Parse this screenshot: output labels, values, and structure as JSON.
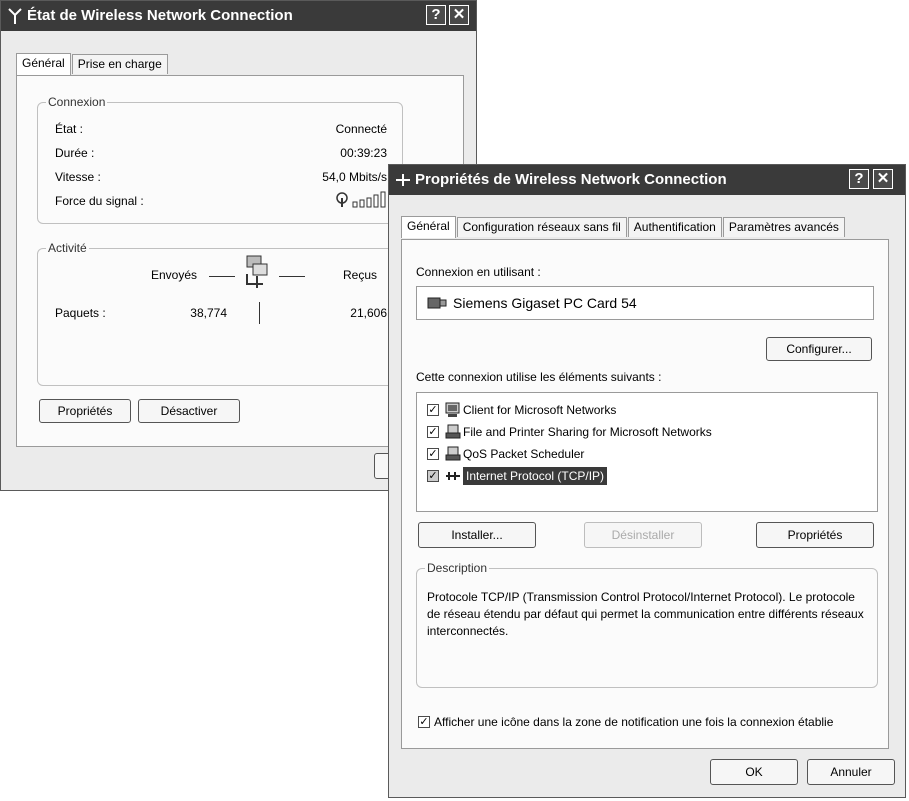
{
  "status_window": {
    "title": "État de Wireless Network Connection",
    "help_btn": "?",
    "close_btn": "✕",
    "tabs": [
      "Général",
      "Prise en charge"
    ],
    "connexion_legend": "Connexion",
    "rows": [
      {
        "label": "État :",
        "value": "Connecté"
      },
      {
        "label": "Durée :",
        "value": "00:39:23"
      },
      {
        "label": "Vitesse :",
        "value": "54,0 Mbits/s"
      },
      {
        "label": "Force du signal :",
        "value": ""
      }
    ],
    "activity_legend": "Activité",
    "sent_label": "Envoyés",
    "received_label": "Reçus",
    "packets_label": "Paquets :",
    "packets_sent": "38,774",
    "packets_received": "21,606",
    "properties_btn": "Propriétés",
    "disable_btn": "Désactiver",
    "signal_bars": 4
  },
  "props_window": {
    "title": "Propriétés de Wireless Network Connection",
    "help_btn": "?",
    "close_btn": "✕",
    "tabs": [
      "Général",
      "Configuration réseaux sans fil",
      "Authentification",
      "Paramètres avancés"
    ],
    "connect_using_label": "Connexion en utilisant :",
    "adapter_name": "Siemens Gigaset PC Card 54",
    "configure_btn": "Configurer...",
    "components_label": "Cette connexion utilise les éléments suivants :",
    "components": [
      {
        "name": "Client for Microsoft Networks",
        "checked": true
      },
      {
        "name": "File and Printer Sharing for Microsoft Networks",
        "checked": true
      },
      {
        "name": "QoS Packet Scheduler",
        "checked": true
      },
      {
        "name": "Internet Protocol (TCP/IP)",
        "checked": true,
        "selected": true
      }
    ],
    "install_btn": "Installer...",
    "uninstall_btn": "Désinstaller",
    "properties_btn": "Propriétés",
    "description_legend": "Description",
    "description_text": "Protocole TCP/IP (Transmission Control Protocol/Internet Protocol). Le protocole de réseau étendu par défaut qui permet la communication entre différents réseaux interconnectés.",
    "show_icon_label": "Afficher une icône dans la zone de notification une fois la connexion établie",
    "show_icon_checked": true,
    "ok_btn": "OK",
    "cancel_btn": "Annuler"
  }
}
